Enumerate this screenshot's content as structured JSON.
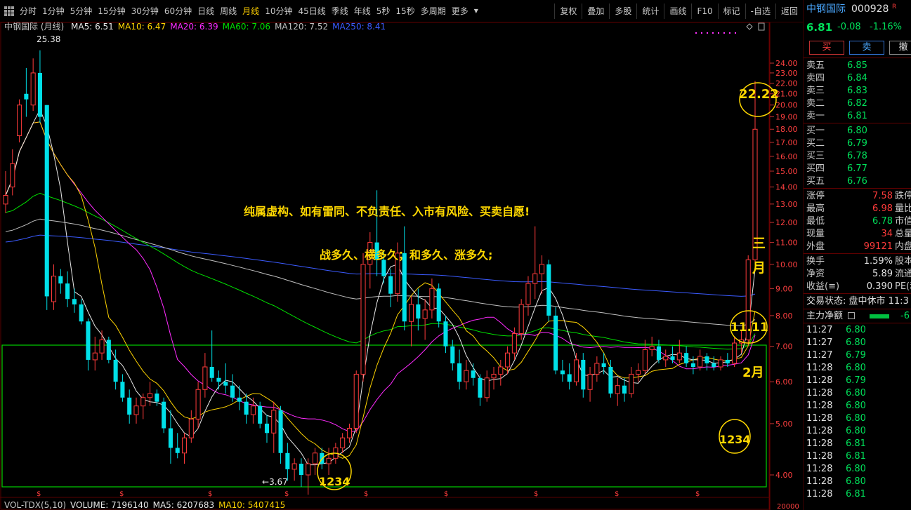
{
  "toolbar": {
    "periods": [
      "分时",
      "1分钟",
      "5分钟",
      "15分钟",
      "30分钟",
      "60分钟",
      "日线",
      "周线",
      "月线",
      "10分钟",
      "45日线",
      "季线",
      "年线",
      "5秒",
      "15秒",
      "多周期",
      "更多"
    ],
    "active_period": "月线",
    "more_suffix": "▼",
    "tools": [
      "复权",
      "叠加",
      "多股",
      "统计",
      "画线",
      "F10",
      "标记",
      "-自选",
      "返回"
    ]
  },
  "legend": {
    "stock_label": "中钢国际 (月线)",
    "ma": [
      {
        "text": "MA5: 6.51",
        "color": "#e8e8e8"
      },
      {
        "text": "MA10: 6.47",
        "color": "#ffd400"
      },
      {
        "text": "MA20: 6.39",
        "color": "#ff2bff"
      },
      {
        "text": "MA60: 7.06",
        "color": "#00e000"
      },
      {
        "text": "MA120: 7.52",
        "color": "#c0c0c0"
      },
      {
        "text": "MA250: 8.41",
        "color": "#3b5bff"
      }
    ]
  },
  "vol_legend": [
    {
      "text": "VOL-TDX(5,10)",
      "color": "#c8c8c8"
    },
    {
      "text": "VOLUME: 7196140",
      "color": "#e8e8e8"
    },
    {
      "text": "MA5: 6207683",
      "color": "#e8e8e8"
    },
    {
      "text": "MA10: 5407415",
      "color": "#ffd400"
    }
  ],
  "annotations": {
    "disclaimer": "纯属虚构、如有雷同、不负责任、入市有风险、买卖自愿!",
    "slogan": "战多久、横多久；和多久、涨多久;",
    "circle_top": "22.22",
    "circle_mid": "11.11",
    "month_label_1": "三",
    "month_label_2": "月",
    "month_label_3": "2月",
    "circle_left": "1234",
    "circle_right": "1234",
    "high_label": "25.38",
    "low_label": "3.67"
  },
  "axis": {
    "y_ticks": [
      "24.00",
      "23.00",
      "22.00",
      "21.00",
      "20.00",
      "19.00",
      "18.00",
      "17.00",
      "16.00",
      "15.00",
      "14.00",
      "13.00",
      "12.00",
      "11.00",
      "10.00",
      "9.00",
      "8.00",
      "7.00",
      "6.00",
      "5.00",
      "4.00"
    ],
    "vol_tick": "20000"
  },
  "chart_data": {
    "type": "candlestick",
    "title": "中钢国际 (月线)",
    "period": "monthly",
    "y_scale": "log",
    "ylim": [
      3.5,
      25.5
    ],
    "candles": [
      {
        "o": 13.0,
        "h": 15.0,
        "l": 12.5,
        "c": 13.5
      },
      {
        "o": 14.0,
        "h": 16.5,
        "l": 13.5,
        "c": 15.5
      },
      {
        "o": 17.5,
        "h": 20.5,
        "l": 17.0,
        "c": 20.0
      },
      {
        "o": 21.0,
        "h": 23.5,
        "l": 19.0,
        "c": 20.5
      },
      {
        "o": 20.0,
        "h": 24.5,
        "l": 19.5,
        "c": 23.0
      },
      {
        "o": 23.0,
        "h": 25.38,
        "l": 18.5,
        "c": 19.0
      },
      {
        "o": 20.0,
        "h": 20.0,
        "l": 8.2,
        "c": 8.7
      },
      {
        "o": 8.5,
        "h": 10.0,
        "l": 8.2,
        "c": 9.5
      },
      {
        "o": 9.5,
        "h": 9.8,
        "l": 8.8,
        "c": 9.2
      },
      {
        "o": 9.2,
        "h": 9.7,
        "l": 8.3,
        "c": 8.6
      },
      {
        "o": 8.6,
        "h": 9.0,
        "l": 8.1,
        "c": 8.4
      },
      {
        "o": 8.4,
        "h": 8.6,
        "l": 7.7,
        "c": 7.8
      },
      {
        "o": 7.8,
        "h": 7.9,
        "l": 6.3,
        "c": 6.6
      },
      {
        "o": 6.6,
        "h": 7.3,
        "l": 6.3,
        "c": 6.8
      },
      {
        "o": 6.8,
        "h": 7.5,
        "l": 6.6,
        "c": 7.2
      },
      {
        "o": 7.2,
        "h": 7.3,
        "l": 6.5,
        "c": 6.6
      },
      {
        "o": 6.6,
        "h": 6.9,
        "l": 5.8,
        "c": 6.0
      },
      {
        "o": 6.0,
        "h": 6.2,
        "l": 5.5,
        "c": 5.6
      },
      {
        "o": 5.6,
        "h": 5.8,
        "l": 5.0,
        "c": 5.2
      },
      {
        "o": 5.2,
        "h": 5.6,
        "l": 5.0,
        "c": 5.4
      },
      {
        "o": 5.4,
        "h": 5.7,
        "l": 5.1,
        "c": 5.6
      },
      {
        "o": 5.6,
        "h": 6.0,
        "l": 5.4,
        "c": 5.7
      },
      {
        "o": 5.7,
        "h": 5.8,
        "l": 5.4,
        "c": 5.5
      },
      {
        "o": 5.5,
        "h": 5.6,
        "l": 4.8,
        "c": 4.9
      },
      {
        "o": 4.9,
        "h": 5.3,
        "l": 4.2,
        "c": 4.5
      },
      {
        "o": 4.5,
        "h": 4.8,
        "l": 4.3,
        "c": 4.4
      },
      {
        "o": 4.4,
        "h": 4.8,
        "l": 4.2,
        "c": 4.7
      },
      {
        "o": 4.7,
        "h": 5.3,
        "l": 4.6,
        "c": 5.1
      },
      {
        "o": 5.1,
        "h": 6.0,
        "l": 4.9,
        "c": 5.8
      },
      {
        "o": 5.8,
        "h": 6.8,
        "l": 5.6,
        "c": 6.4
      },
      {
        "o": 6.4,
        "h": 7.5,
        "l": 6.0,
        "c": 6.1
      },
      {
        "o": 6.1,
        "h": 6.3,
        "l": 5.8,
        "c": 6.0
      },
      {
        "o": 6.0,
        "h": 6.5,
        "l": 5.7,
        "c": 5.9
      },
      {
        "o": 5.9,
        "h": 6.2,
        "l": 5.5,
        "c": 5.6
      },
      {
        "o": 5.6,
        "h": 5.9,
        "l": 5.3,
        "c": 5.5
      },
      {
        "o": 5.5,
        "h": 5.7,
        "l": 5.0,
        "c": 5.2
      },
      {
        "o": 5.2,
        "h": 5.6,
        "l": 5.0,
        "c": 5.4
      },
      {
        "o": 5.4,
        "h": 5.5,
        "l": 4.9,
        "c": 5.0
      },
      {
        "o": 5.0,
        "h": 5.2,
        "l": 4.6,
        "c": 4.8
      },
      {
        "o": 4.8,
        "h": 5.5,
        "l": 4.4,
        "c": 5.3
      },
      {
        "o": 5.3,
        "h": 5.4,
        "l": 4.2,
        "c": 4.4
      },
      {
        "o": 4.4,
        "h": 4.6,
        "l": 3.9,
        "c": 4.1
      },
      {
        "o": 4.1,
        "h": 4.3,
        "l": 3.9,
        "c": 4.2
      },
      {
        "o": 4.2,
        "h": 4.3,
        "l": 3.8,
        "c": 4.0
      },
      {
        "o": 4.0,
        "h": 4.3,
        "l": 3.67,
        "c": 4.2
      },
      {
        "o": 4.2,
        "h": 4.5,
        "l": 4.0,
        "c": 4.4
      },
      {
        "o": 4.4,
        "h": 4.5,
        "l": 4.1,
        "c": 4.2
      },
      {
        "o": 4.2,
        "h": 4.5,
        "l": 4.0,
        "c": 4.3
      },
      {
        "o": 4.3,
        "h": 4.6,
        "l": 4.2,
        "c": 4.5
      },
      {
        "o": 4.5,
        "h": 4.8,
        "l": 4.4,
        "c": 4.7
      },
      {
        "o": 4.7,
        "h": 5.0,
        "l": 4.6,
        "c": 4.9
      },
      {
        "o": 4.9,
        "h": 6.3,
        "l": 4.8,
        "c": 6.2
      },
      {
        "o": 6.2,
        "h": 10.5,
        "l": 6.0,
        "c": 10.0
      },
      {
        "o": 10.0,
        "h": 11.5,
        "l": 9.0,
        "c": 11.0
      },
      {
        "o": 11.0,
        "h": 13.8,
        "l": 9.5,
        "c": 10.2
      },
      {
        "o": 10.2,
        "h": 10.6,
        "l": 9.2,
        "c": 9.5
      },
      {
        "o": 9.5,
        "h": 9.8,
        "l": 8.3,
        "c": 8.8
      },
      {
        "o": 8.8,
        "h": 11.0,
        "l": 8.5,
        "c": 10.5
      },
      {
        "o": 10.5,
        "h": 11.8,
        "l": 7.5,
        "c": 7.8
      },
      {
        "o": 7.8,
        "h": 8.7,
        "l": 7.0,
        "c": 8.4
      },
      {
        "o": 8.4,
        "h": 9.0,
        "l": 7.5,
        "c": 7.9
      },
      {
        "o": 7.9,
        "h": 8.6,
        "l": 7.2,
        "c": 8.2
      },
      {
        "o": 8.2,
        "h": 9.4,
        "l": 7.9,
        "c": 9.0
      },
      {
        "o": 9.0,
        "h": 9.2,
        "l": 7.6,
        "c": 7.8
      },
      {
        "o": 7.8,
        "h": 8.0,
        "l": 6.8,
        "c": 7.0
      },
      {
        "o": 7.0,
        "h": 7.2,
        "l": 6.3,
        "c": 6.5
      },
      {
        "o": 6.5,
        "h": 6.9,
        "l": 5.8,
        "c": 6.0
      },
      {
        "o": 6.0,
        "h": 6.6,
        "l": 5.8,
        "c": 6.3
      },
      {
        "o": 6.3,
        "h": 6.5,
        "l": 5.9,
        "c": 6.1
      },
      {
        "o": 6.1,
        "h": 6.2,
        "l": 5.4,
        "c": 5.6
      },
      {
        "o": 5.6,
        "h": 6.3,
        "l": 5.5,
        "c": 6.1
      },
      {
        "o": 6.1,
        "h": 6.4,
        "l": 5.8,
        "c": 6.2
      },
      {
        "o": 6.2,
        "h": 6.6,
        "l": 5.9,
        "c": 6.4
      },
      {
        "o": 6.4,
        "h": 7.0,
        "l": 6.2,
        "c": 6.8
      },
      {
        "o": 6.8,
        "h": 7.6,
        "l": 6.6,
        "c": 7.4
      },
      {
        "o": 7.4,
        "h": 8.6,
        "l": 7.2,
        "c": 8.4
      },
      {
        "o": 8.4,
        "h": 9.5,
        "l": 8.0,
        "c": 9.2
      },
      {
        "o": 9.2,
        "h": 11.8,
        "l": 8.6,
        "c": 9.6
      },
      {
        "o": 9.6,
        "h": 10.4,
        "l": 8.8,
        "c": 10.0
      },
      {
        "o": 10.0,
        "h": 10.2,
        "l": 7.8,
        "c": 8.0
      },
      {
        "o": 8.0,
        "h": 8.3,
        "l": 6.2,
        "c": 6.3
      },
      {
        "o": 6.3,
        "h": 6.6,
        "l": 6.0,
        "c": 6.2
      },
      {
        "o": 6.2,
        "h": 6.5,
        "l": 5.8,
        "c": 6.0
      },
      {
        "o": 6.0,
        "h": 6.8,
        "l": 5.9,
        "c": 6.6
      },
      {
        "o": 6.6,
        "h": 6.8,
        "l": 5.6,
        "c": 5.8
      },
      {
        "o": 5.8,
        "h": 6.4,
        "l": 5.5,
        "c": 6.2
      },
      {
        "o": 6.2,
        "h": 6.7,
        "l": 6.0,
        "c": 6.5
      },
      {
        "o": 6.5,
        "h": 6.8,
        "l": 6.2,
        "c": 6.4
      },
      {
        "o": 6.4,
        "h": 6.6,
        "l": 5.6,
        "c": 5.7
      },
      {
        "o": 5.7,
        "h": 6.1,
        "l": 5.4,
        "c": 5.9
      },
      {
        "o": 5.9,
        "h": 6.1,
        "l": 5.5,
        "c": 5.7
      },
      {
        "o": 5.7,
        "h": 6.4,
        "l": 5.6,
        "c": 6.2
      },
      {
        "o": 6.2,
        "h": 6.5,
        "l": 6.0,
        "c": 6.3
      },
      {
        "o": 6.3,
        "h": 7.2,
        "l": 6.2,
        "c": 6.9
      },
      {
        "o": 6.9,
        "h": 7.3,
        "l": 6.7,
        "c": 7.0
      },
      {
        "o": 7.0,
        "h": 7.2,
        "l": 6.5,
        "c": 6.6
      },
      {
        "o": 6.6,
        "h": 6.9,
        "l": 6.4,
        "c": 6.7
      },
      {
        "o": 6.7,
        "h": 7.0,
        "l": 6.5,
        "c": 6.6
      },
      {
        "o": 6.6,
        "h": 7.2,
        "l": 6.5,
        "c": 6.8
      },
      {
        "o": 6.8,
        "h": 7.0,
        "l": 6.4,
        "c": 6.5
      },
      {
        "o": 6.5,
        "h": 6.7,
        "l": 6.2,
        "c": 6.4
      },
      {
        "o": 6.4,
        "h": 6.9,
        "l": 6.3,
        "c": 6.7
      },
      {
        "o": 6.7,
        "h": 6.8,
        "l": 6.3,
        "c": 6.5
      },
      {
        "o": 6.5,
        "h": 6.7,
        "l": 6.3,
        "c": 6.4
      },
      {
        "o": 6.4,
        "h": 6.7,
        "l": 6.3,
        "c": 6.6
      },
      {
        "o": 6.6,
        "h": 6.8,
        "l": 6.4,
        "c": 6.5
      },
      {
        "o": 6.5,
        "h": 7.3,
        "l": 6.4,
        "c": 7.1
      },
      {
        "o": 7.1,
        "h": 7.5,
        "l": 6.8,
        "c": 7.2
      },
      {
        "o": 7.2,
        "h": 10.4,
        "l": 7.0,
        "c": 10.2
      },
      {
        "o": 10.2,
        "h": 22.2,
        "l": 10.0,
        "c": 18.0
      }
    ],
    "ma_series": [
      {
        "name": "MA5",
        "color": "#e8e8e8"
      },
      {
        "name": "MA10",
        "color": "#ffd400"
      },
      {
        "name": "MA20",
        "color": "#ff2bff"
      },
      {
        "name": "MA60",
        "color": "#00e000"
      },
      {
        "name": "MA120",
        "color": "#c0c0c0"
      },
      {
        "name": "MA250",
        "color": "#3b5bff"
      }
    ]
  },
  "quote": {
    "name": "中钢国际",
    "code": "000928",
    "flag": "R",
    "price": "6.81",
    "change": "-0.08",
    "change_pct": "-1.16%",
    "buy_btn": "买",
    "sell_btn": "卖",
    "cancel_btn": "撤",
    "asks": [
      {
        "label": "卖五",
        "price": "6.85"
      },
      {
        "label": "卖四",
        "price": "6.84"
      },
      {
        "label": "卖三",
        "price": "6.83"
      },
      {
        "label": "卖二",
        "price": "6.82"
      },
      {
        "label": "卖一",
        "price": "6.81"
      }
    ],
    "bids": [
      {
        "label": "买一",
        "price": "6.80"
      },
      {
        "label": "买二",
        "price": "6.79"
      },
      {
        "label": "买三",
        "price": "6.78"
      },
      {
        "label": "买四",
        "price": "6.77"
      },
      {
        "label": "买五",
        "price": "6.76"
      }
    ],
    "stats": [
      {
        "label": "涨停",
        "value": "7.58",
        "value_color": "#ff3b3b",
        "label2": "跌停"
      },
      {
        "label": "最高",
        "value": "6.98",
        "value_color": "#ff3b3b",
        "label2": "量比"
      },
      {
        "label": "最低",
        "value": "6.78",
        "value_color": "#00e05a",
        "label2": "市值"
      },
      {
        "label": "现量",
        "value": "34",
        "value_color": "#ff3b3b",
        "label2": "总量"
      },
      {
        "label": "外盘",
        "value": "99121",
        "value_color": "#ff3b3b",
        "label2": "内盘"
      }
    ],
    "stats2": [
      {
        "label": "换手",
        "value": "1.59%",
        "label2": "股本"
      },
      {
        "label": "净资",
        "value": "5.89",
        "label2": "流通"
      },
      {
        "label": "收益(≡)",
        "value": "0.390",
        "label2": "PE(动"
      }
    ],
    "trade_status": "交易状态: 盘中休市 11:3",
    "main_flow_label": "主力净额",
    "main_flow_value": "-6",
    "ticks": [
      {
        "time": "11:27",
        "price": "6.80"
      },
      {
        "time": "11:27",
        "price": "6.80"
      },
      {
        "time": "11:27",
        "price": "6.79"
      },
      {
        "time": "11:28",
        "price": "6.80"
      },
      {
        "time": "11:28",
        "price": "6.79"
      },
      {
        "time": "11:28",
        "price": "6.80"
      },
      {
        "time": "11:28",
        "price": "6.80"
      },
      {
        "time": "11:28",
        "price": "6.80"
      },
      {
        "time": "11:28",
        "price": "6.80"
      },
      {
        "time": "11:28",
        "price": "6.81"
      },
      {
        "time": "11:28",
        "price": "6.81"
      },
      {
        "time": "11:28",
        "price": "6.80"
      },
      {
        "time": "11:28",
        "price": "6.80"
      },
      {
        "time": "11:28",
        "price": "6.81"
      }
    ]
  }
}
